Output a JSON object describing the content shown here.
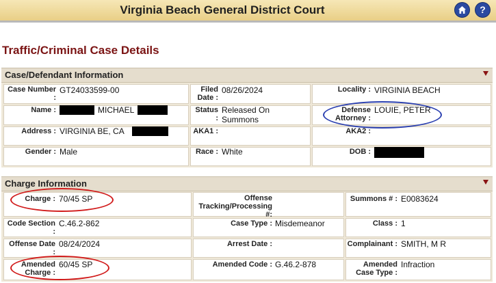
{
  "header": {
    "title": "Virginia Beach General District Court",
    "home_icon": "home-icon",
    "help_icon": "help-icon",
    "help_glyph": "?"
  },
  "page_title": "Traffic/Criminal Case Details",
  "case_section": {
    "title": "Case/Defendant Information",
    "case_number_label": "Case Number :",
    "case_number": "GT24033599-00",
    "filed_label": "Filed Date :",
    "filed_date": "08/26/2024",
    "locality_label": "Locality :",
    "locality": "VIRGINIA BEACH",
    "name_label": "Name :",
    "name_middle": "MICHAEL",
    "status_label": "Status :",
    "status": "Released On Summons",
    "defense_label": "Defense Attorney :",
    "defense_attorney": "LOUIE, PETER",
    "address_label": "Address :",
    "address": "VIRGINIA BE, CA",
    "aka1_label": "AKA1 :",
    "aka2_label": "AKA2 :",
    "gender_label": "Gender :",
    "gender": "Male",
    "race_label": "Race :",
    "race": "White",
    "dob_label": "DOB :"
  },
  "charge_section": {
    "title": "Charge Information",
    "charge_label": "Charge :",
    "charge": "70/45 SP",
    "tracking_label": "Offense Tracking/Processing #:",
    "summons_label": "Summons # :",
    "summons": "E0083624",
    "code_section_label": "Code Section :",
    "code_section": "C.46.2-862",
    "case_type_label": "Case Type :",
    "case_type": "Misdemeanor",
    "class_label": "Class :",
    "class": "1",
    "offense_date_label": "Offense Date :",
    "offense_date": "08/24/2024",
    "arrest_date_label": "Arrest Date :",
    "complainant_label": "Complainant :",
    "complainant": "SMITH, M R",
    "amended_charge_label": "Amended Charge :",
    "amended_charge": "60/45 SP",
    "amended_code_label": "Amended Code :",
    "amended_code": "G.46.2-878",
    "amended_case_type_label": "Amended Case Type :",
    "amended_case_type": "Infraction"
  },
  "colors": {
    "header_bg": "#e9cf86",
    "title_red": "#7b1414",
    "section_bg": "#e5ddcd",
    "red_ellipse": "#d11a1a",
    "blue_ellipse": "#2a3fb0"
  }
}
